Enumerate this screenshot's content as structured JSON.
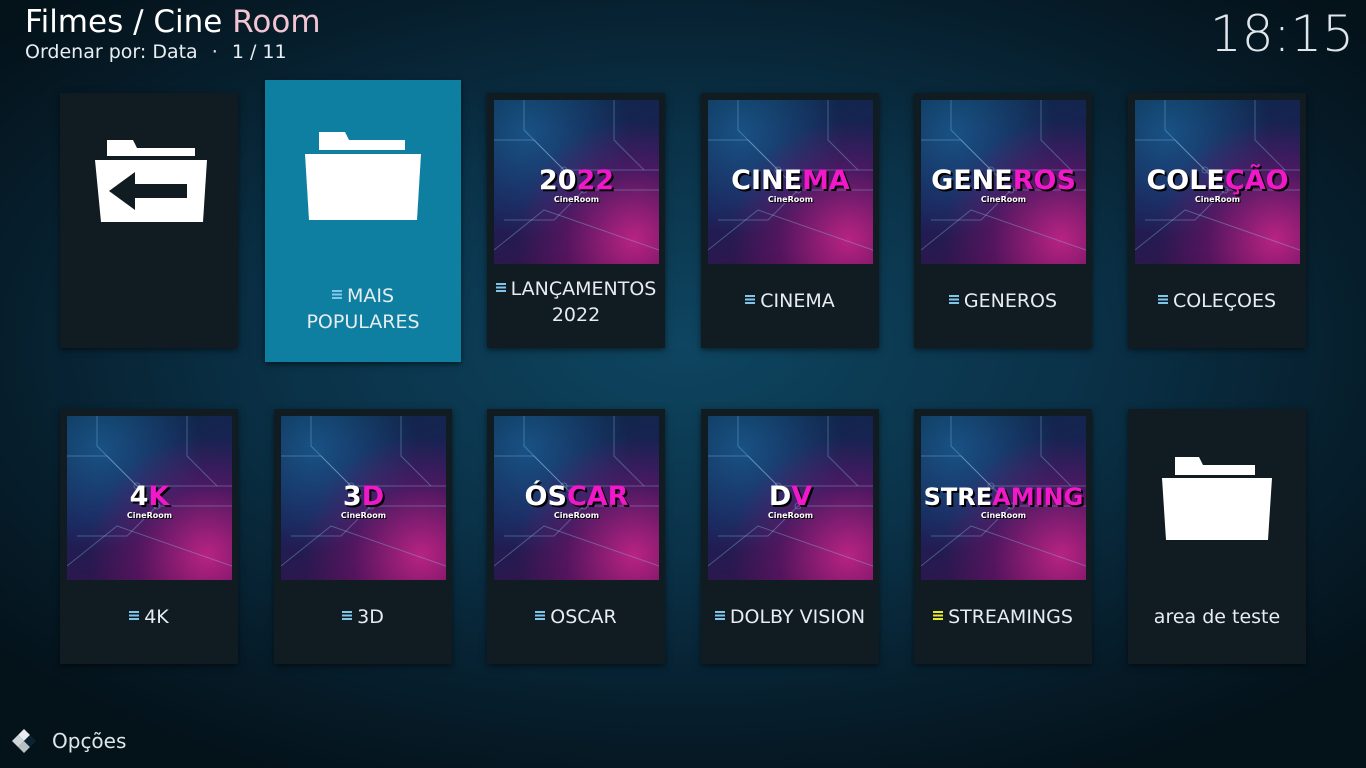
{
  "header": {
    "section": "Filmes",
    "separator": " / ",
    "name_part1": "Cine",
    "name_part2": "Room",
    "sort_label": "Ordenar por: Data",
    "dot": "·",
    "page": "1 / 11"
  },
  "clock": "18:15",
  "tiles": [
    {
      "label": "",
      "type": "back",
      "icon": "folder-back-icon"
    },
    {
      "label_1": "MAIS",
      "label_2": "POPULARES",
      "type": "folder",
      "focused": true,
      "icon": "folder-icon"
    },
    {
      "label_1": "LANÇAMENTOS",
      "label_2": "2022",
      "thumb_text_white": "20",
      "thumb_text_pink": "22",
      "thumb_brand": "CineRoom"
    },
    {
      "label": "CINEMA",
      "thumb_text_white": "CINE",
      "thumb_text_pink": "MA",
      "thumb_brand": "CineRoom"
    },
    {
      "label": "GENEROS",
      "thumb_text_white": "GENE",
      "thumb_text_pink": "ROS",
      "thumb_brand": "CineRoom"
    },
    {
      "label": "COLEÇOES",
      "thumb_text_white": "COLE",
      "thumb_text_pink": "ÇÃO",
      "thumb_brand": "CineRoom"
    },
    {
      "label": "4K",
      "thumb_text_white": "4",
      "thumb_text_pink": "K",
      "thumb_brand": "CineRoom"
    },
    {
      "label": "3D",
      "thumb_text_white": "3",
      "thumb_text_pink": "D",
      "thumb_brand": "CineRoom"
    },
    {
      "label": "OSCAR",
      "thumb_text_white": "ÓS",
      "thumb_text_pink": "CAR",
      "thumb_brand": "CineRoom"
    },
    {
      "label": "DOLBY VISION",
      "thumb_text_white": "D",
      "thumb_text_pink": "V",
      "thumb_brand": "CineRoom"
    },
    {
      "label": "STREAMINGS",
      "thumb_text_white": "STRE",
      "thumb_text_pink": "AMING",
      "thumb_brand": "CineRoom",
      "list_color": "#e8e830"
    },
    {
      "label": "area de teste",
      "type": "folder",
      "icon": "folder-icon"
    }
  ],
  "options": {
    "label": "Opções",
    "icon": "options-icon"
  },
  "colors": {
    "focus": "#0e7fa1",
    "accent_pink": "#f018c8",
    "list_icon": "#7fc6ea"
  }
}
